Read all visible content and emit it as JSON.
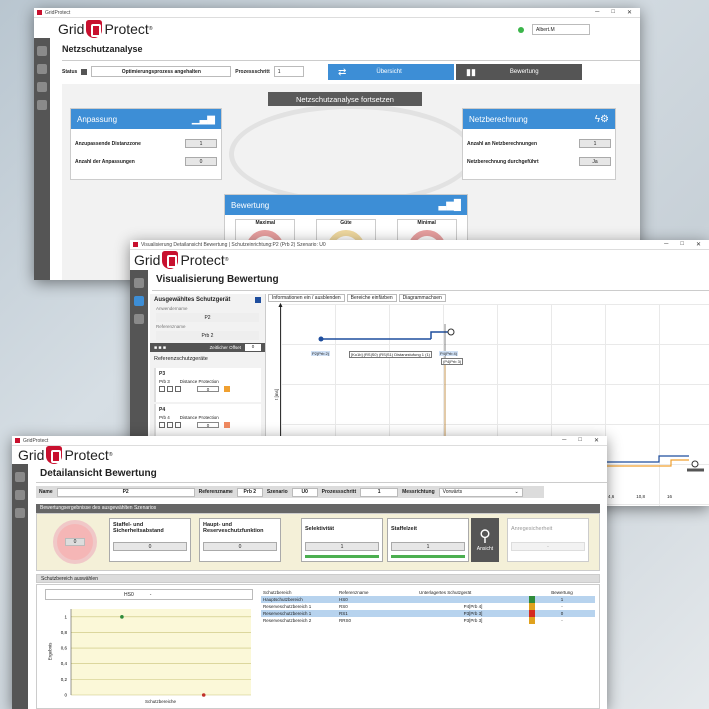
{
  "win1": {
    "title": "GridProtect",
    "logo_left": "Grid",
    "logo_right": "Protect",
    "logo_mark": "®",
    "user": "Albert.M",
    "heading": "Netzschutzanalyse",
    "status_label": "Status",
    "status_value": "Optimierungsprozess angehalten",
    "step_label": "Prozessschritt",
    "step_value": "1",
    "tab_overview": "Übersicht",
    "tab_rating": "Bewertung",
    "continue_button": "Netzschutzanalyse fortsetzen",
    "adapt": {
      "title": "Anpassung",
      "row1_label": "Anzupassende Distanzzone",
      "row1_value": "1",
      "row2_label": "Anzahl der Anpassungen",
      "row2_value": "0"
    },
    "calc": {
      "title": "Netzberechnung",
      "row1_label": "Anzahl an Netzberechnungen",
      "row1_value": "1",
      "row2_label": "Netzberechnung durchgeführt",
      "row2_value": "Ja"
    },
    "rating": {
      "title": "Bewertung",
      "col1": "Maximal",
      "col2": "Güte",
      "col3": "Minimal"
    }
  },
  "win2": {
    "title": "Visualisierung Detailansicht Bewertung | Schutzeinrichtung:P2 (Prb 2) Szenario: U0",
    "logo_left": "Grid",
    "logo_right": "Protect",
    "logo_mark": "®",
    "heading": "Visualisierung Bewertung",
    "selected_label": "Ausgewähltes Schutzgerät",
    "app_name_label": "Anwendername",
    "app_name_value": "P2",
    "ref_name_label": "Referenzname",
    "ref_name_value": "Prb 2",
    "offset_label": "Zeitlicher Offset",
    "offset_value": "0",
    "ref_devices_label": "Referenzschutzgeräte",
    "devices": [
      {
        "name": "P3",
        "sub": "Prb 3",
        "type": "Distance Protection",
        "value": "0"
      },
      {
        "name": "P4",
        "sub": "Prb 4",
        "type": "Distance Protection",
        "value": "0"
      }
    ],
    "tabs": [
      "Informationen ein / ausblenden",
      "Bereiche einfärben",
      "Diagrammachsen"
    ],
    "yaxis_label": "t [ms]",
    "chart_labels": [
      "P2(Prb 2)",
      "[Ko1b] (RS|S0) (RS|S1) Distanzstufung 1 (1)",
      "P4(Prb 4)",
      "(P4|Prb 3)"
    ],
    "xticks": [
      "0",
      "4,6",
      "10,8",
      "16"
    ]
  },
  "win3": {
    "title": "GridProtect",
    "logo_left": "Grid",
    "logo_right": "Protect",
    "logo_mark": "®",
    "heading": "Detailansicht Bewertung",
    "fields": {
      "name_label": "Name",
      "name_value": "P2",
      "ref_label": "Referenzname",
      "ref_value": "Prb 2",
      "scen_label": "Szenario",
      "scen_value": "U0",
      "step_label": "Prozessschritt",
      "step_value": "1",
      "dir_label": "Messrichtung",
      "dir_value": "Vorwärts"
    },
    "results_header": "Bewertungsergebnisse des ausgewählten Szenarios",
    "score": "0",
    "cards": [
      {
        "title": "Staffel- und Sicherheitsabstand",
        "value": "0"
      },
      {
        "title": "Haupt- und Reserveschutzfunktion",
        "value": "0"
      },
      {
        "title": "Selektivität",
        "value": "1"
      },
      {
        "title": "Staffelzeit",
        "value": "1"
      }
    ],
    "view_button": "Ansicht",
    "extra_card": {
      "title": "Anregesicherheit",
      "value": "-"
    },
    "zone_header": "Schutzbereich auswählen",
    "zone_dropdown": "HS0",
    "zone_dropdown_right": "-",
    "chart_ylabel": "Ergebnis",
    "chart_xlabel": "Schutzbereiche",
    "table_headers": [
      "Schutzbereich",
      "Referenzname",
      "Unterlagertes Schutzgerät",
      "Bewertung"
    ],
    "table_rows": [
      {
        "c1": "Hauptschutzbereich",
        "c2": "HS0",
        "c3": "",
        "c4": "1",
        "color": "#2e8b3a",
        "sel": true
      },
      {
        "c1": "Reserveschutzbereich 1",
        "c2": "RS0",
        "c3": "P4[Prb 4]",
        "c4": "-",
        "color": "#e0a21e",
        "sel": false
      },
      {
        "c1": "Reserveschutzbereich 1",
        "c2": "RS1",
        "c3": "P3[Prb 3]",
        "c4": "0",
        "color": "#d42a1f",
        "sel": true
      },
      {
        "c1": "Reserveschutzbereich 2",
        "c2": "RRS0",
        "c3": "P3[Prb 3]",
        "c4": "-",
        "color": "#e0a21e",
        "sel": false
      }
    ]
  },
  "chart_data": {
    "type": "scatter",
    "x": [
      "HS0",
      "RS0"
    ],
    "values": [
      1,
      0
    ],
    "ylim": [
      0,
      1.1
    ],
    "yticks": [
      "0",
      "0,2",
      "0,4",
      "0,6",
      "0,8",
      "1"
    ],
    "ylabel": "Ergebnis",
    "xlabel": "Schutzbereiche"
  }
}
